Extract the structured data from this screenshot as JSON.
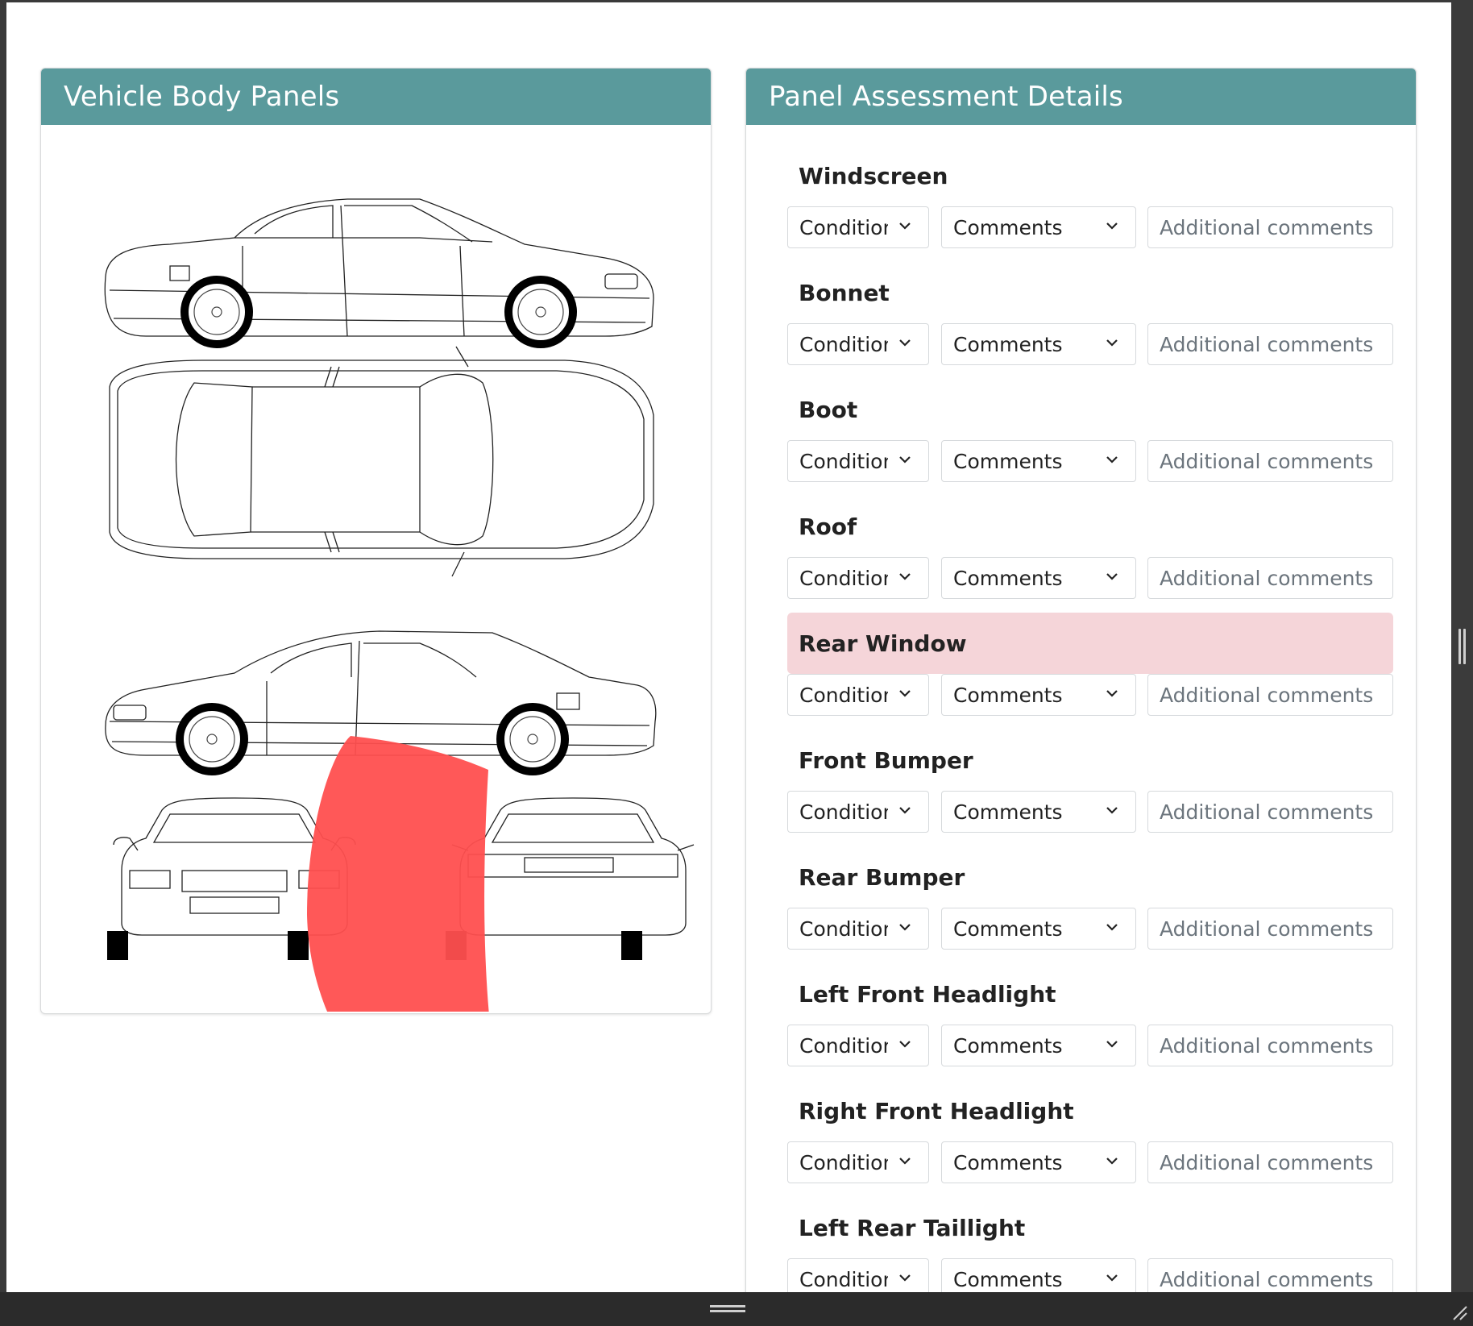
{
  "left_card": {
    "title": "Vehicle Body Panels"
  },
  "right_card": {
    "title": "Panel Assessment Details"
  },
  "condition_label": "Condition",
  "comments_label": "Comments",
  "additional_placeholder": "Additional comments",
  "panels": [
    {
      "name": "Windscreen",
      "highlighted": false
    },
    {
      "name": "Bonnet",
      "highlighted": false
    },
    {
      "name": "Boot",
      "highlighted": false
    },
    {
      "name": "Roof",
      "highlighted": false
    },
    {
      "name": "Rear Window",
      "highlighted": true
    },
    {
      "name": "Front Bumper",
      "highlighted": false
    },
    {
      "name": "Rear Bumper",
      "highlighted": false
    },
    {
      "name": "Left Front Headlight",
      "highlighted": false
    },
    {
      "name": "Right Front Headlight",
      "highlighted": false
    },
    {
      "name": "Left Rear Taillight",
      "highlighted": false
    }
  ],
  "colors": {
    "header": "#5a9a9c",
    "highlight_row": "#f5d5d9",
    "damage_marker": "#ff4f4f"
  },
  "icons": {
    "select_arrow": "chevron-down-icon"
  }
}
